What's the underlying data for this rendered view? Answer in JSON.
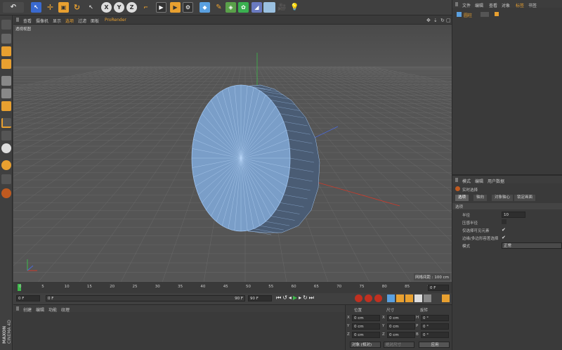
{
  "colors": {
    "accent_orange": "#e8a030",
    "viewport_bg": "#555555",
    "mesh_fill": "#7a9ec8",
    "mesh_line": "#9fc4f0",
    "axis_green": "#3db84a",
    "axis_red": "#d03a2a",
    "axis_blue": "#4a6ad8"
  },
  "toolbar": {
    "icons": [
      "undo-icon",
      "select-icon",
      "move-icon",
      "scale-icon",
      "rotate-icon",
      "cursor-icon",
      "x-lock-icon",
      "y-lock-icon",
      "z-lock-icon",
      "coordinate-icon",
      "render-view-icon",
      "render-picture-icon",
      "render-settings-icon",
      "cube-icon",
      "pen-icon",
      "subdivision-icon",
      "array-icon",
      "deformer-icon",
      "floor-icon",
      "camera-icon",
      "light-icon"
    ],
    "x_label": "X",
    "y_label": "Y",
    "z_label": "Z"
  },
  "viewport_menu": [
    "查看",
    "摄像机",
    "显示",
    "选项",
    "过滤",
    "面板",
    "ProRender"
  ],
  "viewport": {
    "label": "透视视图",
    "grid_label": "网格间距 : 100 cm"
  },
  "timeline": {
    "ticks": [
      "0",
      "5",
      "10",
      "15",
      "20",
      "25",
      "30",
      "35",
      "40",
      "45",
      "50",
      "55",
      "60",
      "65",
      "70",
      "75",
      "80",
      "85",
      "90"
    ],
    "end_field": "0 F"
  },
  "transport": {
    "start_field": "0 F",
    "scrub_start": "0 F",
    "scrub_end": "90 F",
    "end_field": "90 F"
  },
  "materials": {
    "menu": [
      "创建",
      "编辑",
      "功能",
      "纹理"
    ]
  },
  "coords": {
    "headers": [
      "位置",
      "尺寸",
      "旋转"
    ],
    "rows": [
      {
        "a": "X",
        "av": "0 cm",
        "b": "X",
        "bv": "0 cm",
        "c": "H",
        "cv": "0 °"
      },
      {
        "a": "Y",
        "av": "0 cm",
        "b": "Y",
        "bv": "0 cm",
        "c": "P",
        "cv": "0 °"
      },
      {
        "a": "Z",
        "av": "0 cm",
        "b": "Z",
        "bv": "0 cm",
        "c": "B",
        "cv": "0 °"
      }
    ],
    "mode": "对象 (相对)",
    "size_mode": "绝对尺寸",
    "apply": "应用"
  },
  "objects": {
    "menu": [
      "文件",
      "编辑",
      "查看",
      "对象",
      "标签",
      "书签"
    ],
    "item": "圆柱"
  },
  "attributes": {
    "menu": [
      "模式",
      "编辑",
      "用户数据"
    ],
    "tool": "实时选择",
    "tabs": [
      "选项",
      "轴向",
      "对象轴心",
      "锁定画面"
    ],
    "section": "选项",
    "radius_label": "半径",
    "radius_value": "10",
    "pressure_label": "压感半径",
    "visible_label": "仅选择可见元素",
    "soft_label": "边缘/多边形容差选择",
    "mode_label": "模式",
    "mode_value": "正常"
  },
  "brand": {
    "line1": "MAXON",
    "line2": "CINEMA 4D"
  }
}
